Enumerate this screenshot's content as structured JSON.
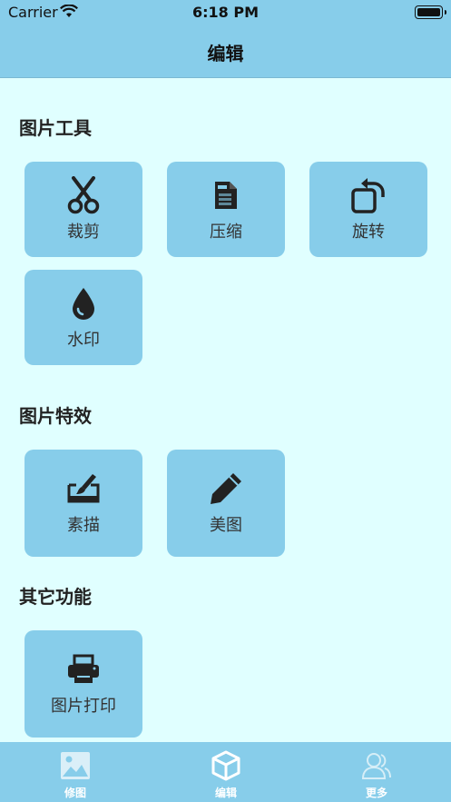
{
  "status_bar": {
    "carrier": "Carrier",
    "time": "6:18 PM"
  },
  "nav": {
    "title": "编辑"
  },
  "sections": {
    "tools": {
      "title": "图片工具",
      "items": [
        {
          "label": "裁剪",
          "icon": "scissors-icon"
        },
        {
          "label": "压缩",
          "icon": "rar-file-icon"
        },
        {
          "label": "旋转",
          "icon": "rotate-icon"
        },
        {
          "label": "水印",
          "icon": "drop-icon"
        }
      ]
    },
    "effects": {
      "title": "图片特效",
      "items": [
        {
          "label": "素描",
          "icon": "paint-brush-icon"
        },
        {
          "label": "美图",
          "icon": "pencil-icon"
        }
      ]
    },
    "other": {
      "title": "其它功能",
      "items": [
        {
          "label": "图片打印",
          "icon": "printer-icon"
        }
      ]
    }
  },
  "tab_bar": {
    "items": [
      {
        "label": "修图",
        "icon": "image-icon",
        "active": false
      },
      {
        "label": "编辑",
        "icon": "cube-icon",
        "active": true
      },
      {
        "label": "更多",
        "icon": "users-icon",
        "active": false
      }
    ]
  },
  "colors": {
    "header": "#87cdea",
    "background": "#e0ffff",
    "tile": "#87cdea",
    "icon": "#222222"
  }
}
